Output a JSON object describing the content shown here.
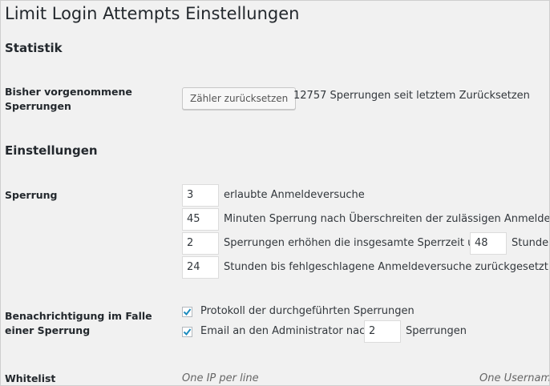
{
  "page": {
    "title": "Limit Login Attempts Einstellungen"
  },
  "statistik": {
    "heading": "Statistik",
    "label": "Bisher vorgenommene Sperrungen",
    "reset_button": "Zähler zurücksetzen",
    "count_text": "12757 Sperrungen seit letztem Zurücksetzen"
  },
  "einstellungen": {
    "heading": "Einstellungen",
    "sperrung": {
      "label": "Sperrung",
      "allowed_retries": {
        "value": "3",
        "text": "erlaubte Anmeldeversuche"
      },
      "lockout_duration": {
        "value": "45",
        "text": "Minuten Sperrung nach Überschreiten der zulässigen Anmeldevers"
      },
      "increase": {
        "value": "2",
        "text": "Sperrungen erhöhen die insgesamte Sperrzeit um",
        "hours_value": "48",
        "hours_text": "Stunden"
      },
      "reset_hours": {
        "value": "24",
        "text": "Stunden bis fehlgeschlagene Anmeldeversuche zurückgesetzt werd"
      }
    },
    "benachrichtigung": {
      "label": "Benachrichtigung im Falle einer Sperrung",
      "log": {
        "checked": true,
        "text": "Protokoll der durchgeführten Sperrungen"
      },
      "email": {
        "checked": true,
        "text": "Email an den Administrator nach",
        "value": "2",
        "suffix": "Sperrungen"
      }
    },
    "whitelist": {
      "label": "Whitelist",
      "ip_placeholder": "One IP per line",
      "username_placeholder": "One Username"
    }
  }
}
